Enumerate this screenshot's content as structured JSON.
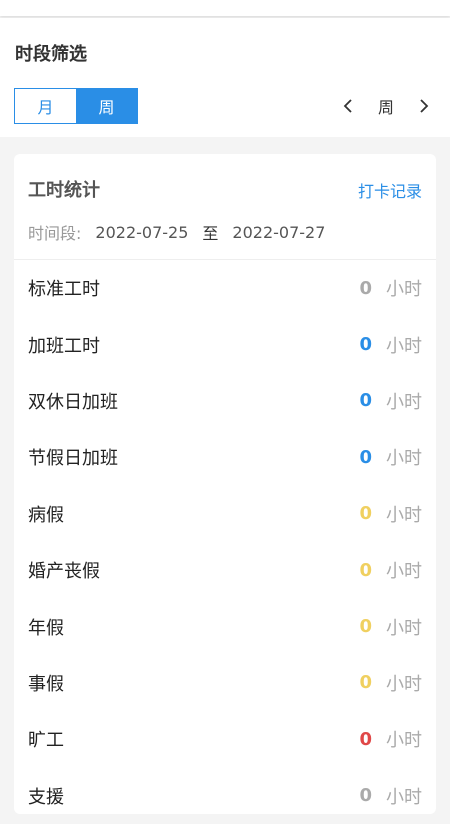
{
  "filter": {
    "title": "时段筛选",
    "segments": {
      "month": "月",
      "week": "周",
      "selected": "周"
    },
    "pager_label": "周"
  },
  "card": {
    "title": "工时统计",
    "link": "打卡记录",
    "period_label": "时间段:",
    "start_date": "2022-07-25",
    "to": "至",
    "end_date": "2022-07-27"
  },
  "rows": [
    {
      "name": "标准工时",
      "value": "0",
      "unit": "小时",
      "color": "#aaaaaa"
    },
    {
      "name": "加班工时",
      "value": "0",
      "unit": "小时",
      "color": "#2a8ee6"
    },
    {
      "name": "双休日加班",
      "value": "0",
      "unit": "小时",
      "color": "#2a8ee6"
    },
    {
      "name": "节假日加班",
      "value": "0",
      "unit": "小时",
      "color": "#2a8ee6"
    },
    {
      "name": "病假",
      "value": "0",
      "unit": "小时",
      "color": "#f0d060"
    },
    {
      "name": "婚产丧假",
      "value": "0",
      "unit": "小时",
      "color": "#f0d060"
    },
    {
      "name": "年假",
      "value": "0",
      "unit": "小时",
      "color": "#f0d060"
    },
    {
      "name": "事假",
      "value": "0",
      "unit": "小时",
      "color": "#f0d060"
    },
    {
      "name": "旷工",
      "value": "0",
      "unit": "小时",
      "color": "#e04848"
    },
    {
      "name": "支援",
      "value": "0",
      "unit": "小时",
      "color": "#aaaaaa"
    }
  ],
  "icons": {
    "prev": "chevron-left-icon",
    "next": "chevron-right-icon"
  }
}
